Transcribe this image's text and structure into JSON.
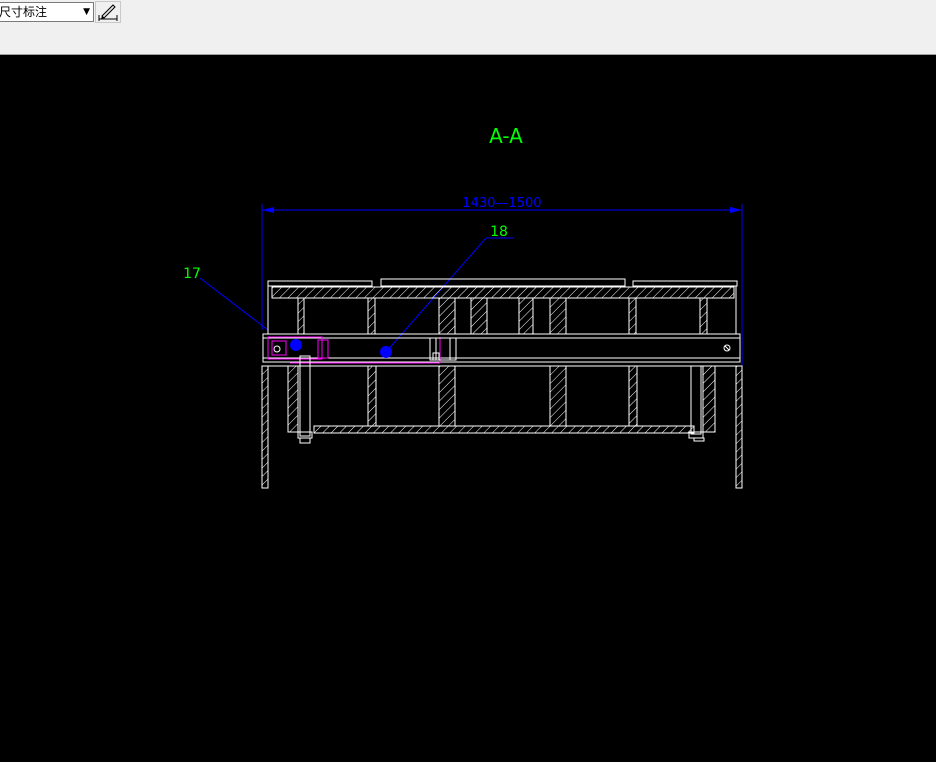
{
  "toolbar": {
    "dim_style_value": "尺寸标注",
    "dim_style_icon": "dimension-style-edit-icon"
  },
  "drawing": {
    "section_title": "A-A",
    "dimension_text": "1430—1500",
    "callouts": [
      "17",
      "18"
    ],
    "colors": {
      "background": "#000000",
      "geometry": "#ffffff",
      "dimension": "#0000ff",
      "annotation": "#00ff00",
      "highlight": "#ff00ff",
      "grip": "#0000ff"
    }
  }
}
